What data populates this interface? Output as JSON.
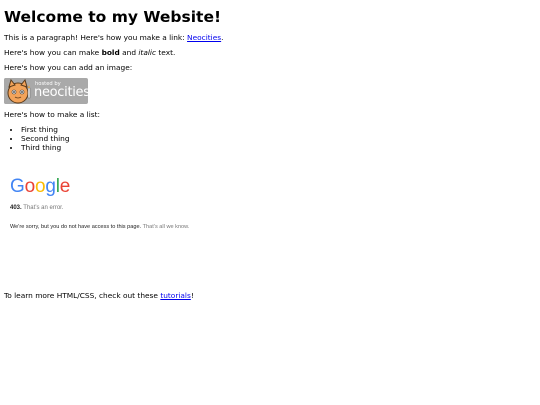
{
  "heading": "Welcome to my Website!",
  "paragraph1": {
    "before": "This is a paragraph! Here's how you make a link: ",
    "link": "Neocities",
    "after": "."
  },
  "paragraph2": {
    "before": "Here's how you can make ",
    "bold": "bold",
    "middle": " and ",
    "italic": "italic",
    "after": " text."
  },
  "paragraph3": "Here's how you can add an image:",
  "badge": {
    "small_text": "hosted by",
    "big_text": "neocities",
    "icon": "neocities-cat-icon"
  },
  "paragraph4": "Here's how to make a list:",
  "list": [
    "First thing",
    "Second thing",
    "Third thing"
  ],
  "embed": {
    "logo_letters": [
      "G",
      "o",
      "o",
      "g",
      "l",
      "e"
    ],
    "error_code": "403.",
    "error_short": "That’s an error.",
    "error_message": "We're sorry, but you do not have access to this page.",
    "error_tail": "That’s all we know."
  },
  "paragraph5": {
    "before": "To learn more HTML/CSS, check out these ",
    "link": "tutorials",
    "after": "!"
  }
}
